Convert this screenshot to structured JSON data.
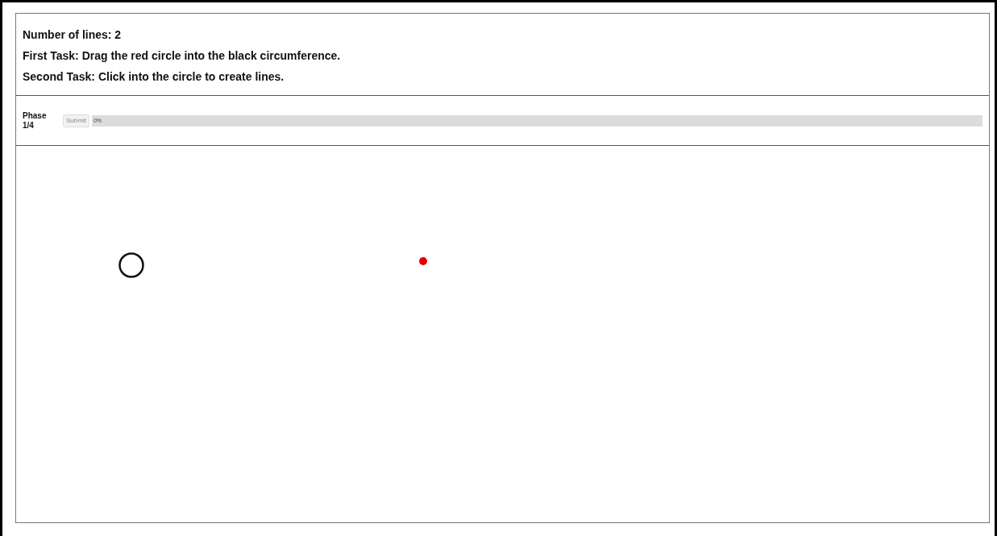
{
  "instructions": [
    "Number of lines: 2",
    "First Task: Drag the red circle into the black circumference.",
    "Second Task: Click into the circle to create lines."
  ],
  "phase": {
    "label": "Phase 1/4",
    "submit": {
      "label": "Submit",
      "disabled": true
    },
    "progress": {
      "level": 0,
      "reading": "0%"
    }
  }
}
